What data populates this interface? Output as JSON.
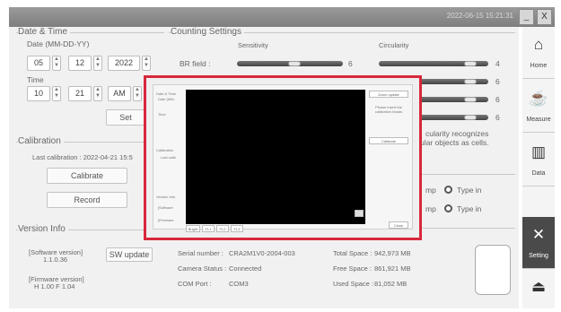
{
  "topbar": {
    "datetime": "2022-06-15 15:21:31",
    "minimize": "_",
    "close": "X"
  },
  "datetime_section": {
    "title": "Date & Time",
    "date_label": "Date (MM-DD-YY)",
    "month": "05",
    "day": "12",
    "year": "2022",
    "time_label": "Time",
    "hour": "10",
    "minute": "21",
    "ampm": "AM",
    "set_button": "Set"
  },
  "counting": {
    "title": "Counting Settings",
    "sensitivity_header": "Sensitivity",
    "circularity_header": "Circularity",
    "br_label": "BR field :",
    "br_sensitivity": "6",
    "circ_values": [
      "4",
      "6",
      "6",
      "6"
    ],
    "sensitivity_level": 0.55,
    "circularity_levels": [
      0.88,
      0.88,
      0.88,
      0.88
    ],
    "note_line1": "cularity recognizes",
    "note_line2": "ular objects as cells."
  },
  "calibration": {
    "title": "Calibration",
    "last_calibration": "Last calibration : 2022-04-21 15:5",
    "calibrate_button": "Calibrate",
    "record_button": "Record"
  },
  "options": {
    "item1_suffix": "mp",
    "item1_radio": "Type in",
    "item2_suffix": "mp",
    "item2_radio": "Type in"
  },
  "version": {
    "title": "Version Info",
    "software_label": "[Software version]",
    "software_value": "1.1.0.36",
    "sw_update_button": "SW update",
    "firmware_label": "[Firmware version]",
    "firmware_value": "H 1.00  F 1.04"
  },
  "device": {
    "serial_label": "Serial number :",
    "serial_value": "CRA2M1V0-2004-003",
    "camera_label": "Camera Status :",
    "camera_value": "Connected",
    "com_label": "COM Port :",
    "com_value": "COM3"
  },
  "storage": {
    "total_label": "Total Space :",
    "total_value": "942,973 MB",
    "free_label": "Free Space :",
    "free_value": "861,921 MB",
    "used_label": "Used Space :",
    "used_value": "81,052 MB"
  },
  "sidebar": {
    "items": [
      {
        "label": "Home",
        "icon": "home-icon"
      },
      {
        "label": "Measure",
        "icon": "measure-icon"
      },
      {
        "label": "Data",
        "icon": "data-chart-icon"
      },
      {
        "label": "Setting",
        "icon": "tools-icon"
      }
    ],
    "eject_icon": "eject-icon"
  },
  "popup": {
    "left_title": "Date & Time",
    "left_sub": "Date (MM-",
    "left_time": "Time",
    "calibration": "Calibration",
    "last": "Last calib",
    "version": "Version Info",
    "software": "[Software",
    "firmware": "[Firmware",
    "right_button_top": "Zoom update",
    "right_instr": "Please insert the calibration beads",
    "right_button_mid": "Calibrate",
    "close_button": "Close",
    "tabs": [
      "Bright",
      "FL1",
      "FL2",
      "FL3"
    ]
  },
  "colors": {
    "highlight": "#d8283c",
    "active_sidebar": "#4a4a4a",
    "slider": "#555555"
  }
}
